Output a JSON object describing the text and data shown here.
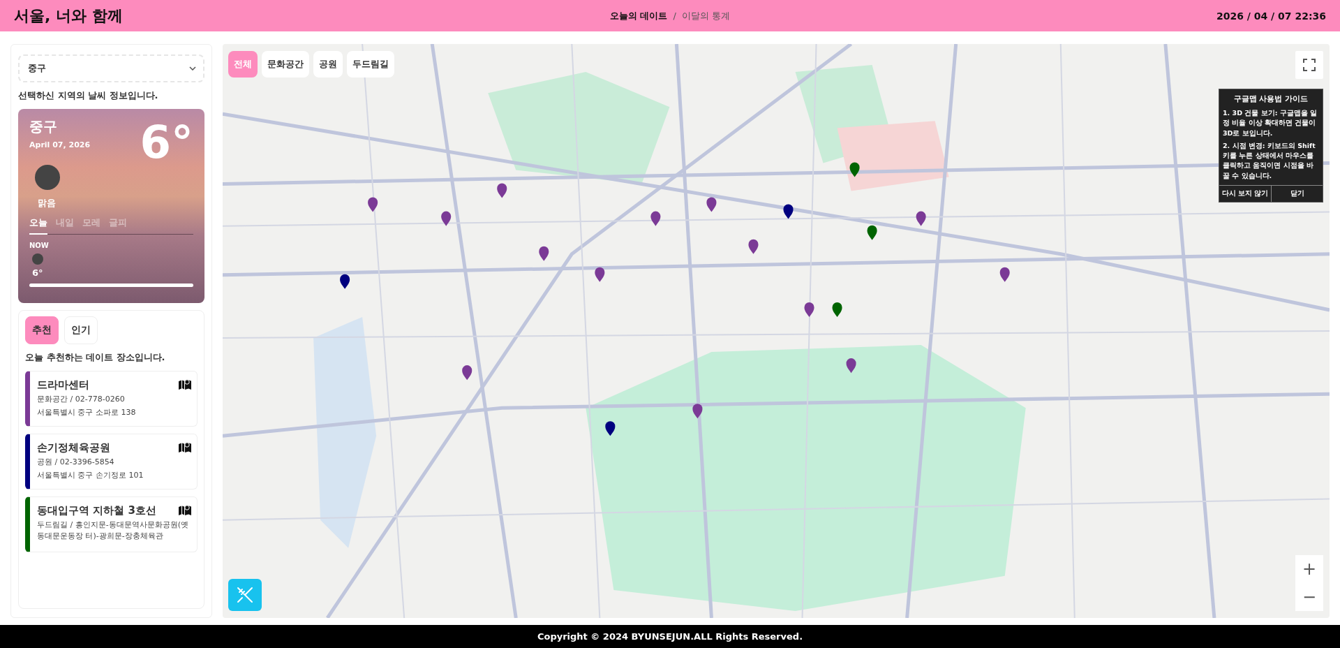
{
  "header": {
    "title": "서울, 너와 함께",
    "nav": [
      {
        "label": "오늘의 데이트",
        "selected": true
      },
      {
        "label": "이달의 통계",
        "selected": false
      }
    ],
    "separator": "/",
    "datetime": "2026 / 04 / 07 22:36"
  },
  "sidebar": {
    "district_select": {
      "value": "중구"
    },
    "weather_intro": "선택하신 지역의 날씨 정보입니다.",
    "weather": {
      "district": "중구",
      "date": "April 07, 2026",
      "temperature": "6°",
      "condition": "맑음",
      "days": [
        {
          "label": "오늘",
          "selected": true
        },
        {
          "label": "내일",
          "selected": false
        },
        {
          "label": "모레",
          "selected": false
        },
        {
          "label": "글피",
          "selected": false
        }
      ],
      "hourly": {
        "time": "NOW",
        "temperature": "6°"
      }
    },
    "rec_tabs": [
      {
        "label": "추천",
        "selected": true
      },
      {
        "label": "인기",
        "selected": false
      }
    ],
    "rec_intro": "오늘 추천하는 데이트 장소입니다.",
    "places": [
      {
        "name": "드라마센터",
        "info": "문화공간 / 02-778-0260",
        "detail": "서울특별시 중구 소파로 138",
        "color": "#7b3a96"
      },
      {
        "name": "손기정체육공원",
        "info": "공원 / 02-3396-5854",
        "detail": "서울특별시 중구 손기정로 101",
        "color": "#00007f"
      },
      {
        "name": "동대입구역 지하철 3호선",
        "info": "두드림길 / 흥인지문-동대문역사문화공원(옛 동대문운동장 터)-광희문-장충체육관",
        "color": "#006400"
      }
    ]
  },
  "map": {
    "filters": [
      {
        "label": "전체",
        "selected": true
      },
      {
        "label": "문화공간",
        "selected": false
      },
      {
        "label": "공원",
        "selected": false
      },
      {
        "label": "두드림길",
        "selected": false
      }
    ],
    "guide": {
      "title": "구글맵 사용법 가이드",
      "steps": [
        "1. 3D 건물 보기: 구글맵을 일정 비율 이상 확대하면 건물이 3D로 보입니다.",
        "2. 시점 변경: 키보드의 Shift 키를 누른 상태에서 마우스를 클릭하고 움직이면 시점을 바꿀 수 있습니다."
      ],
      "buttons": [
        "다시 보지 않기",
        "닫기"
      ]
    },
    "zoom_in": "+",
    "zoom_out": "−"
  },
  "footer": "Copyright © 2024 BYUNSEJUN.ALL Rights Reserved."
}
